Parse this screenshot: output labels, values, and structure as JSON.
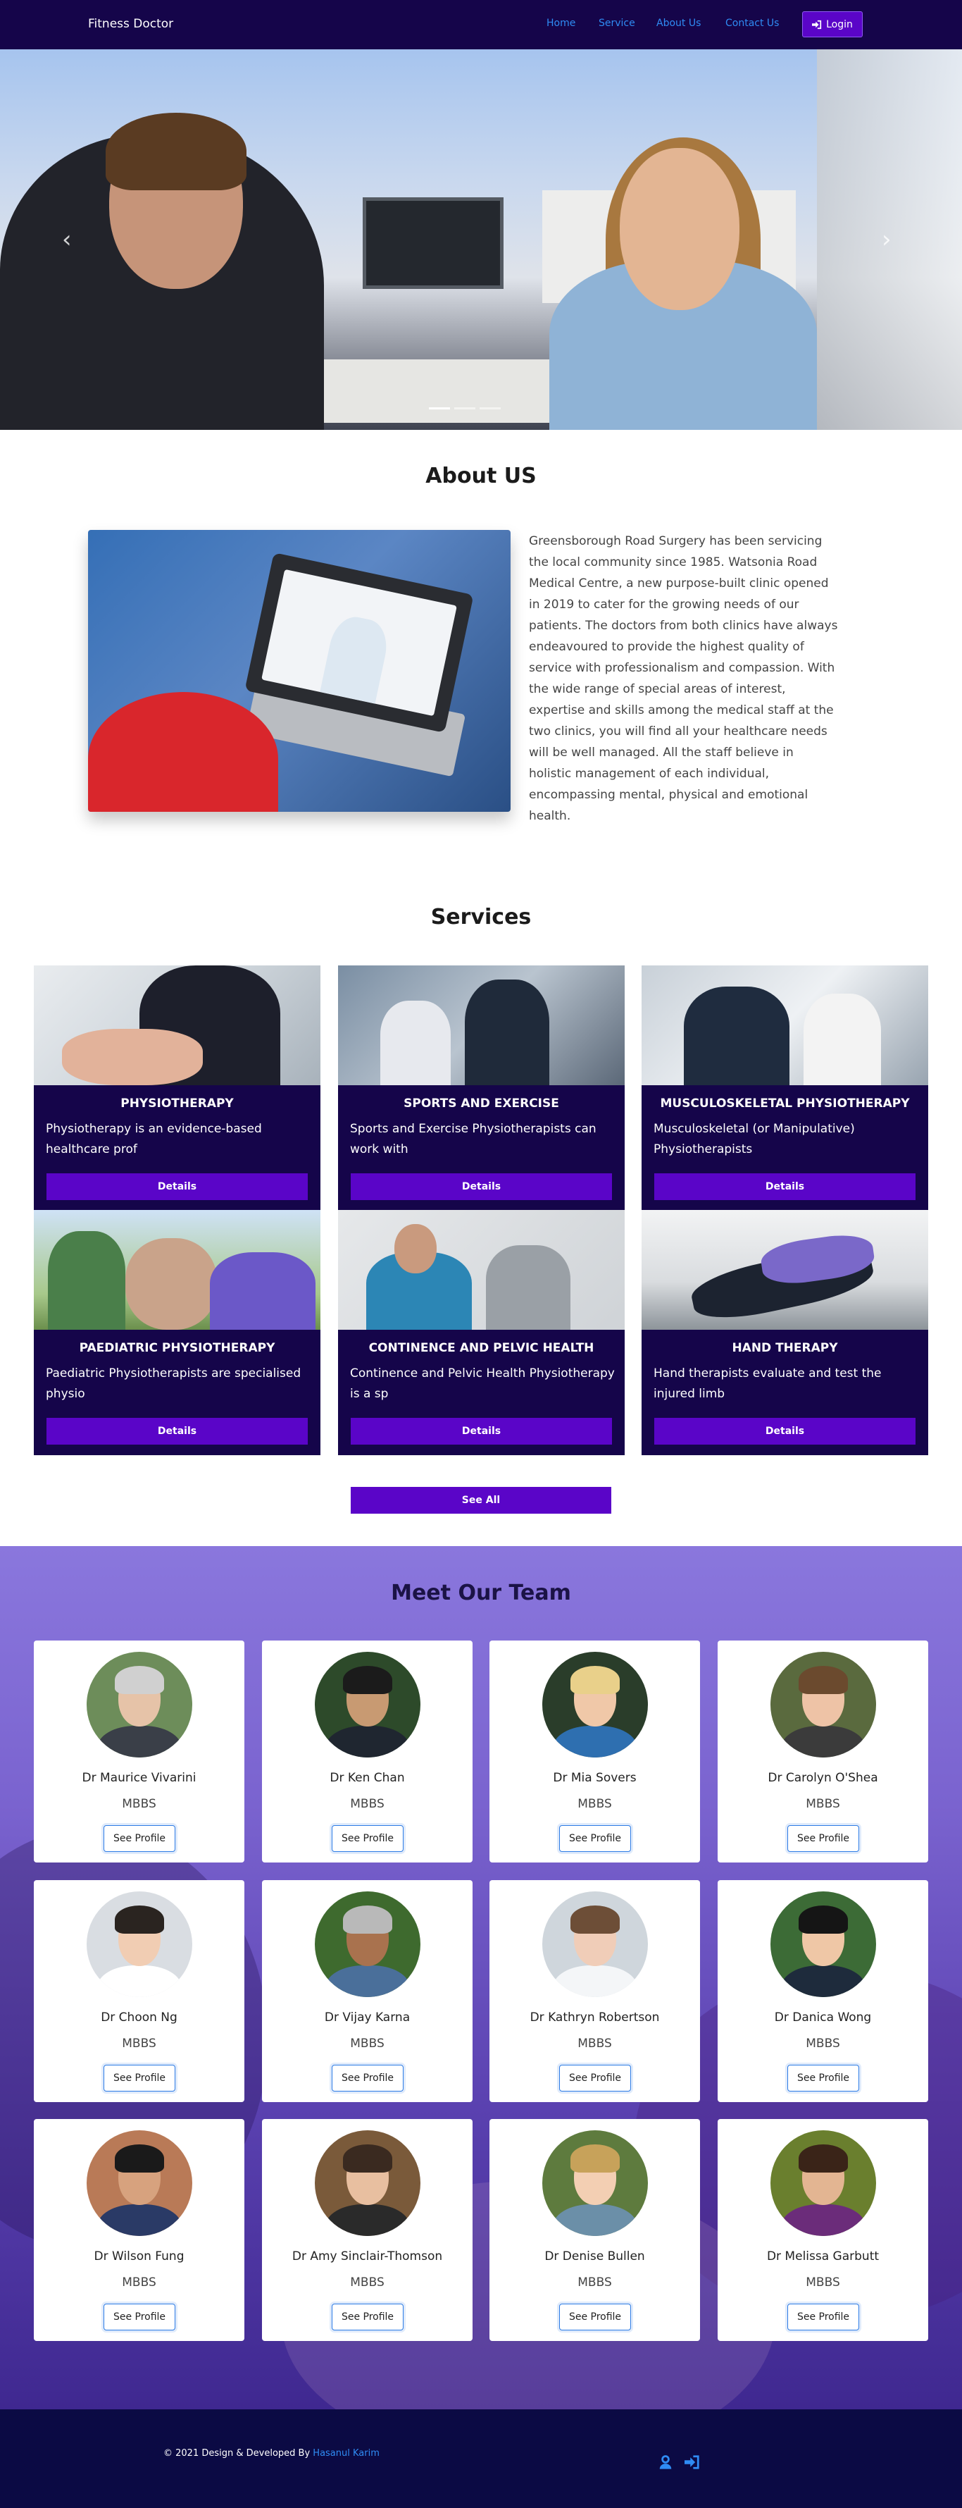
{
  "navbar": {
    "brand": "Fitness Doctor",
    "links": [
      "Home",
      "Service",
      "About Us",
      "Contact Us"
    ],
    "login_label": "Login",
    "login_icon": "sign-in-icon"
  },
  "hero": {
    "prev_icon": "chevron-left-icon",
    "next_icon": "chevron-right-icon",
    "slides": 3
  },
  "about": {
    "title": "About US",
    "text": "Greensborough Road Surgery has been servicing the local community since 1985. Watsonia Road Medical Centre, a new purpose-built clinic opened in 2019 to cater for the growing needs of our patients. The doctors from both clinics have always endeavoured to provide the highest quality of service with professionalism and compassion. With the wide range of special areas of interest, expertise and skills among the medical staff at the two clinics, you will find all your healthcare needs will be well managed. All the staff believe in holistic management of each individual, encompassing mental, physical and emotional health."
  },
  "services": {
    "title": "Services",
    "details_label": "Details",
    "see_all_label": "See All",
    "items": [
      {
        "title": "PHYSIOTHERAPY",
        "desc": "Physiotherapy is an evidence-based healthcare prof"
      },
      {
        "title": "SPORTS AND EXERCISE",
        "desc": "Sports and Exercise Physiotherapists can work with"
      },
      {
        "title": "MUSCULOSKELETAL PHYSIOTHERAPY",
        "desc": "Musculoskeletal (or Manipulative) Physiotherapists"
      },
      {
        "title": "PAEDIATRIC PHYSIOTHERAPY",
        "desc": "Paediatric Physiotherapists are specialised physio"
      },
      {
        "title": "CONTINENCE AND PELVIC HEALTH",
        "desc": "Continence and Pelvic Health Physiotherapy is a sp"
      },
      {
        "title": "HAND THERAPY",
        "desc": "Hand therapists evaluate and test the injured limb"
      }
    ]
  },
  "team": {
    "title": "Meet Our Team",
    "profile_label": "See Profile",
    "doctors": [
      {
        "name": "Dr Maurice Vivarini",
        "degree": "MBBS"
      },
      {
        "name": "Dr Ken Chan",
        "degree": "MBBS"
      },
      {
        "name": "Dr Mia Sovers",
        "degree": "MBBS"
      },
      {
        "name": "Dr Carolyn O'Shea",
        "degree": "MBBS"
      },
      {
        "name": "Dr Choon Ng",
        "degree": "MBBS"
      },
      {
        "name": "Dr Vijay Karna",
        "degree": "MBBS"
      },
      {
        "name": "Dr Kathryn Robertson",
        "degree": "MBBS"
      },
      {
        "name": "Dr Danica Wong",
        "degree": "MBBS"
      },
      {
        "name": "Dr Wilson Fung",
        "degree": "MBBS"
      },
      {
        "name": "Dr Amy Sinclair-Thomson",
        "degree": "MBBS"
      },
      {
        "name": "Dr Denise Bullen",
        "degree": "MBBS"
      },
      {
        "name": "Dr Melissa Garbutt",
        "degree": "MBBS"
      }
    ]
  },
  "footer": {
    "text": "© 2021 Design & Developed By",
    "author": "Hasanul Karim",
    "icons": [
      "user-icon",
      "sign-in-icon"
    ]
  },
  "colors": {
    "navbar_bg": "#15054a",
    "accent": "#5a05c8",
    "link": "#2f8cf4",
    "footer_bg": "#0b0a44"
  }
}
